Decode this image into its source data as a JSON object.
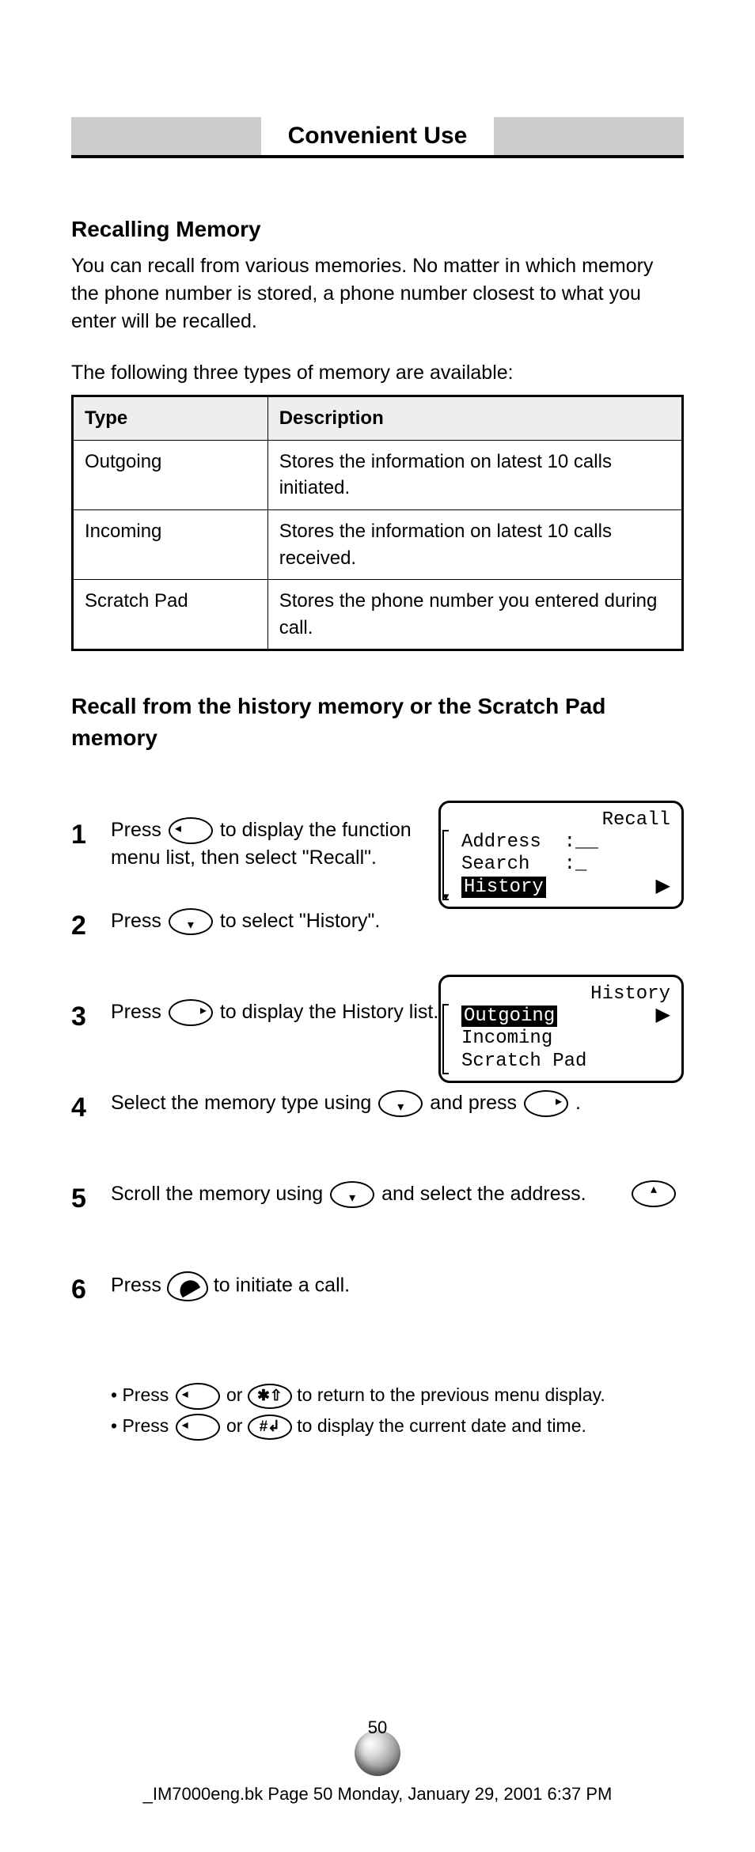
{
  "header": {
    "tab_title": "Convenient Use"
  },
  "intro": {
    "heading": "Recalling Memory",
    "body": "You can recall from various memories.  No matter in which memory the phone number is stored, a phone number closest to what you enter will be recalled."
  },
  "table_heading": "The following three types of memory are available:",
  "memory_table": {
    "headers": [
      "Type",
      "Description"
    ],
    "rows": [
      {
        "type": "Outgoing",
        "desc": "Stores the information on latest 10 calls initiated."
      },
      {
        "type": "Incoming",
        "desc": "Stores the information on latest 10 calls received."
      },
      {
        "type": "Scratch Pad",
        "desc": "Stores the phone number you entered during call."
      }
    ]
  },
  "procedure_heading": "Recall from the history memory or the Scratch Pad memory",
  "steps": [
    {
      "num": "1",
      "text_before": "Press ",
      "text_after": " to display the function menu list, then select \"Recall\"."
    },
    {
      "num": "2",
      "text_before": "Press ",
      "text_after": " to select \"History\"."
    },
    {
      "num": "3",
      "text_before": "Press ",
      "text_after": " to display the History list."
    },
    {
      "num": "4",
      "text_before": "Select the memory type using ",
      "text_middle": " and press ",
      "text_after": "."
    },
    {
      "num": "5",
      "text_before": "Scroll the memory using ",
      "text_after": " and select the address."
    },
    {
      "num": "6",
      "text_before": "Press ",
      "text_after": " to initiate a call."
    }
  ],
  "notes": [
    {
      "prefix": "• Press ",
      "mid": " or ",
      "suffix": " to return to the previous menu display."
    },
    {
      "prefix": "• Press ",
      "mid": " or ",
      "suffix": " to display the current date and time."
    }
  ],
  "screens": {
    "recall": {
      "title": "Recall",
      "lines": [
        {
          "label": "Address",
          "value": ":__"
        },
        {
          "label": "Search",
          "value": ":_"
        },
        {
          "label": "History",
          "highlight": true,
          "arrow": true
        }
      ]
    },
    "history": {
      "title": "History",
      "lines": [
        {
          "label": "Outgoing",
          "highlight": true,
          "arrow": true
        },
        {
          "label": "Incoming"
        },
        {
          "label": "Scratch Pad"
        }
      ]
    }
  },
  "key_labels": {
    "star": "✱⇧",
    "hash": "#↲"
  },
  "footer": {
    "page_number": "50",
    "filename": "_IM7000eng.bk  Page 50  Monday, January 29, 2001  6:37 PM"
  }
}
